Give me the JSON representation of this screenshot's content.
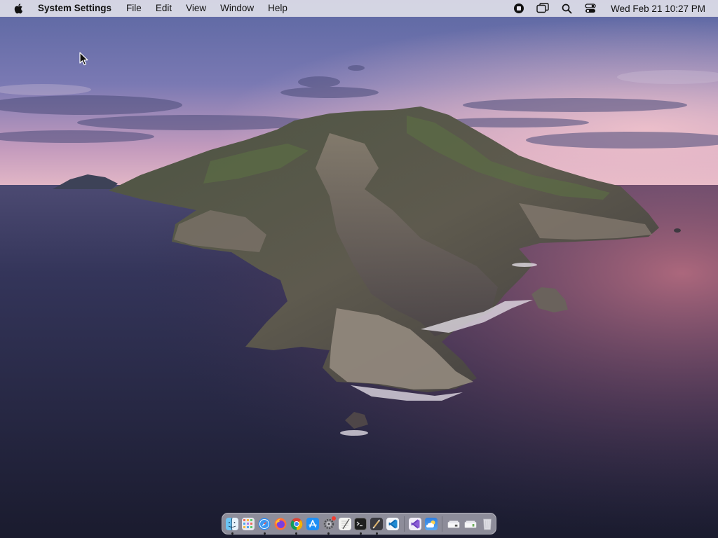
{
  "menubar": {
    "app_name": "System Settings",
    "menus": [
      "File",
      "Edit",
      "View",
      "Window",
      "Help"
    ],
    "clock": "Wed Feb 21  10:27 PM",
    "status_icons": [
      "screen-record-icon",
      "screen-mirroring-icon",
      "spotlight-search-icon",
      "control-center-icon"
    ]
  },
  "dock": {
    "apps": [
      {
        "name": "finder",
        "running": true
      },
      {
        "name": "launchpad",
        "running": false
      },
      {
        "name": "safari",
        "running": true
      },
      {
        "name": "firefox",
        "running": false
      },
      {
        "name": "chrome",
        "running": true
      },
      {
        "name": "app-store",
        "running": false
      },
      {
        "name": "system-settings",
        "running": true,
        "badge": true
      },
      {
        "name": "textedit",
        "running": false
      },
      {
        "name": "terminal",
        "running": true
      },
      {
        "name": "script-editor",
        "running": true
      },
      {
        "name": "vscode",
        "running": false
      }
    ],
    "recent": [
      {
        "name": "visual-studio",
        "running": false
      },
      {
        "name": "weather",
        "running": false
      }
    ],
    "stacks": [
      "downloads-stack",
      "documents-stack",
      "trash"
    ]
  },
  "colors": {
    "menubar_bg": "#e8e6ee",
    "sky_top": "#5f6aa3",
    "sky_horizon": "#d9a8be",
    "sea_dark": "#1c1e33",
    "sea_glow": "#a86478"
  }
}
